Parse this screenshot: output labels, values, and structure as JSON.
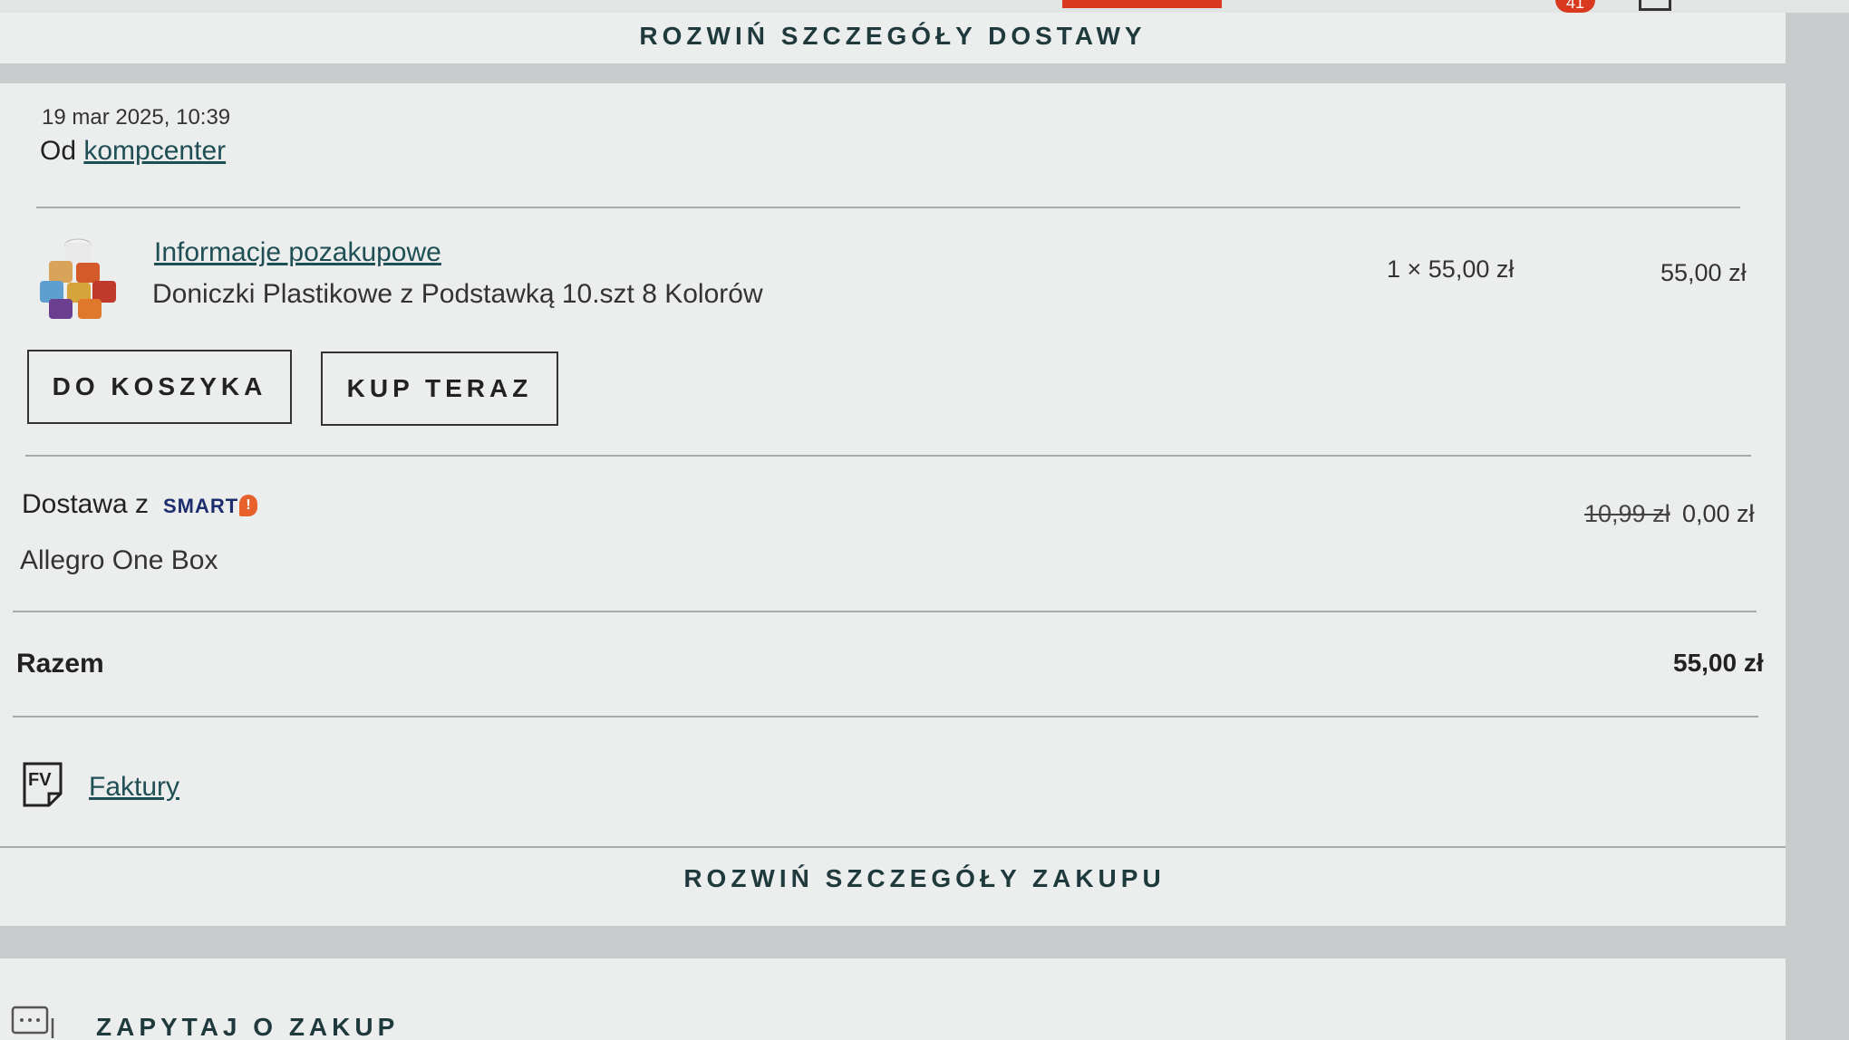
{
  "topbar": {
    "notification_count": "41"
  },
  "expand_delivery_label": "ROZWIŃ SZCZEGÓŁY DOSTAWY",
  "order": {
    "date": "19 mar 2025, 10:39",
    "from_prefix": "Od",
    "seller": "kompcenter",
    "item": {
      "info_link": "Informacje pozakupowe",
      "name": "Doniczki Plastikowe z Podstawką 10.szt 8 Kolorów",
      "quantity_price": "1 × 55,00 zł",
      "total": "55,00 zł"
    },
    "buttons": {
      "add_to_cart": "DO KOSZYKA",
      "buy_now": "KUP TERAZ"
    },
    "delivery": {
      "label": "Dostawa z",
      "smart_badge": "SMART",
      "method": "Allegro One Box",
      "old_price": "10,99 zł",
      "price": "0,00 zł"
    },
    "total": {
      "label": "Razem",
      "value": "55,00 zł"
    },
    "invoices": {
      "icon_text": "FV",
      "label": "Faktury"
    }
  },
  "expand_purchase_label": "ROZWIŃ SZCZEGÓŁY ZAKUPU",
  "ask": {
    "label": "ZAPYTAJ O ZAKUP"
  },
  "colors": {
    "accent_link": "#1f4f55",
    "smart": "#1d2e6e",
    "smart_icon": "#e8612c",
    "alert": "#d93a1f"
  }
}
